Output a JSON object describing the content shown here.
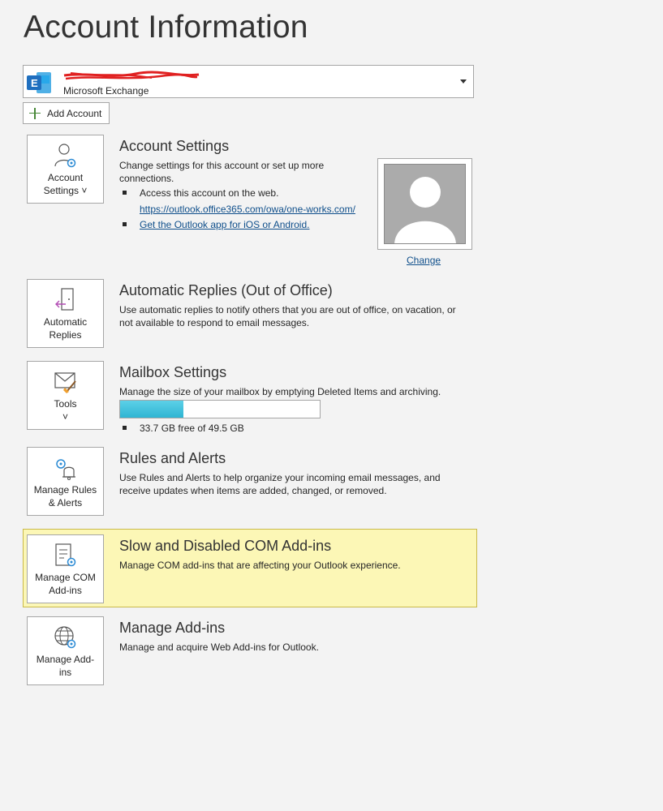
{
  "page": {
    "title": "Account Information"
  },
  "account_selector": {
    "account_type": "Microsoft Exchange",
    "email_redacted_icon": "redaction-scribble"
  },
  "add_account": {
    "label": "Add Account",
    "icon": "plus-icon"
  },
  "sections": {
    "account_settings": {
      "tile_label_line1": "Account",
      "tile_label_line2": "Settings ˅",
      "title": "Account Settings",
      "desc": "Change settings for this account or set up more connections.",
      "bullet1": "Access this account on the web.",
      "link1": "https://outlook.office365.com/owa/one-works.com/",
      "link2": "Get the Outlook app for iOS or Android.",
      "change_label": "Change"
    },
    "auto_replies": {
      "tile_label_line1": "Automatic",
      "tile_label_line2": "Replies",
      "title": "Automatic Replies (Out of Office)",
      "desc": "Use automatic replies to notify others that you are out of office, on vacation, or not available to respond to email messages."
    },
    "mailbox": {
      "tile_label_line1": "Tools",
      "tile_label_line2": "˅",
      "title": "Mailbox Settings",
      "desc": "Manage the size of your mailbox by emptying Deleted Items and archiving.",
      "quota_used_fraction": 0.319,
      "quota_text": "33.7 GB free of 49.5 GB",
      "quota_color": "#2fb5d3"
    },
    "rules": {
      "tile_label_line1": "Manage Rules",
      "tile_label_line2": "& Alerts",
      "title": "Rules and Alerts",
      "desc": "Use Rules and Alerts to help organize your incoming email messages, and receive updates when items are added, changed, or removed."
    },
    "com_addins": {
      "tile_label_line1": "Manage COM",
      "tile_label_line2": "Add-ins",
      "title": "Slow and Disabled COM Add-ins",
      "desc": "Manage COM add-ins that are affecting your Outlook experience.",
      "highlight_color": "#fcf7b6"
    },
    "addins": {
      "tile_label_line1": "Manage Add-",
      "tile_label_line2": "ins",
      "title": "Manage Add-ins",
      "desc": "Manage and acquire Web Add-ins for Outlook."
    }
  },
  "colors": {
    "accent_link": "#0f4f8b",
    "exchange_blue": "#1f6fbf"
  }
}
